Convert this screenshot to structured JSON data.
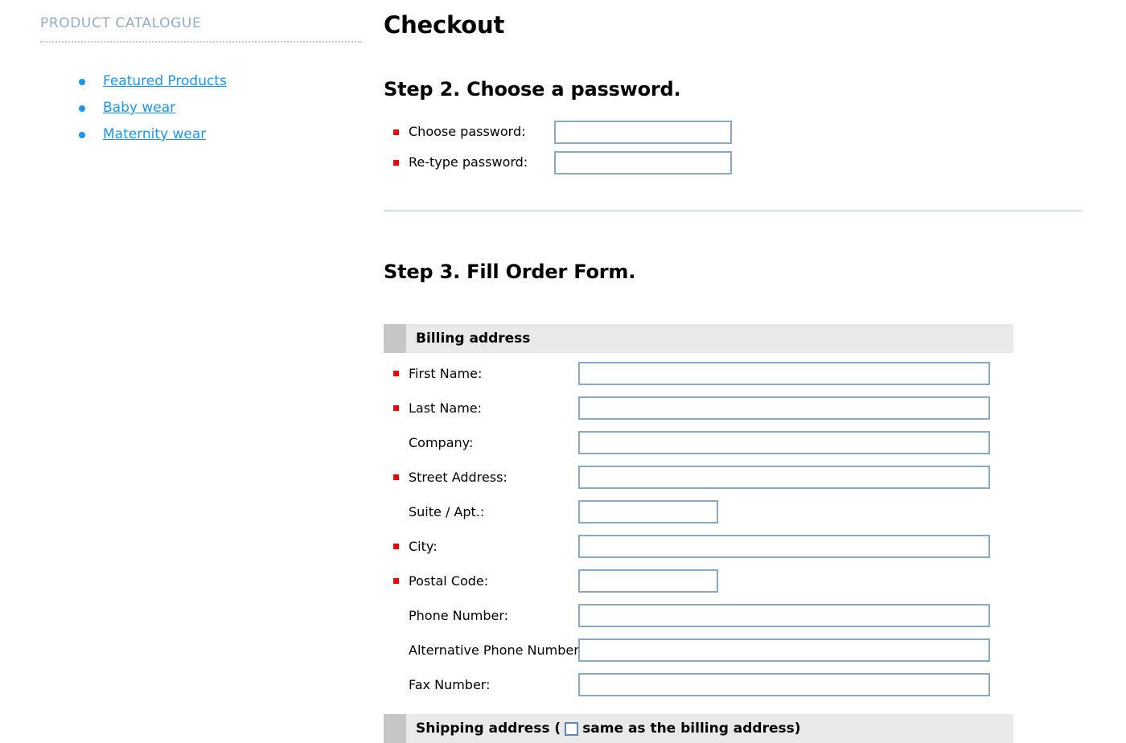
{
  "colors": {
    "link": "#1b95f0",
    "sidebar_heading": "#93acc4",
    "required_marker": "#ef0000",
    "input_border": "#8aa8c4",
    "section_header_bg": "#e9e9e9",
    "section_swatch": "#c6c6c6",
    "divider": "#cfe0ee"
  },
  "sidebar": {
    "heading": "PRODUCT CATALOGUE",
    "items": [
      {
        "label": "Featured Products"
      },
      {
        "label": "Baby wear"
      },
      {
        "label": "Maternity wear"
      }
    ]
  },
  "main": {
    "page_title": "Checkout",
    "step2": {
      "heading": "Step 2. Choose a password.",
      "fields": [
        {
          "label": "Choose password:",
          "value": "",
          "required": true
        },
        {
          "label": "Re-type password:",
          "value": "",
          "required": true
        }
      ]
    },
    "step3": {
      "heading": "Step 3. Fill Order Form.",
      "billing": {
        "title": "Billing address",
        "fields": [
          {
            "label": "First Name:",
            "value": "",
            "required": true,
            "size": "wide"
          },
          {
            "label": "Last Name:",
            "value": "",
            "required": true,
            "size": "wide"
          },
          {
            "label": "Company:",
            "value": "",
            "required": false,
            "size": "wide"
          },
          {
            "label": "Street Address:",
            "value": "",
            "required": true,
            "size": "wide"
          },
          {
            "label": "Suite / Apt.:",
            "value": "",
            "required": false,
            "size": "short"
          },
          {
            "label": "City:",
            "value": "",
            "required": true,
            "size": "wide"
          },
          {
            "label": "Postal Code:",
            "value": "",
            "required": true,
            "size": "short"
          },
          {
            "label": "Phone Number:",
            "value": "",
            "required": false,
            "size": "wide"
          },
          {
            "label": "Alternative Phone Number:",
            "value": "",
            "required": false,
            "size": "wide"
          },
          {
            "label": "Fax Number:",
            "value": "",
            "required": false,
            "size": "wide"
          }
        ]
      },
      "shipping": {
        "title_prefix": "Shipping address (",
        "checkbox_label": "same as the billing address)",
        "checked": false
      }
    }
  }
}
